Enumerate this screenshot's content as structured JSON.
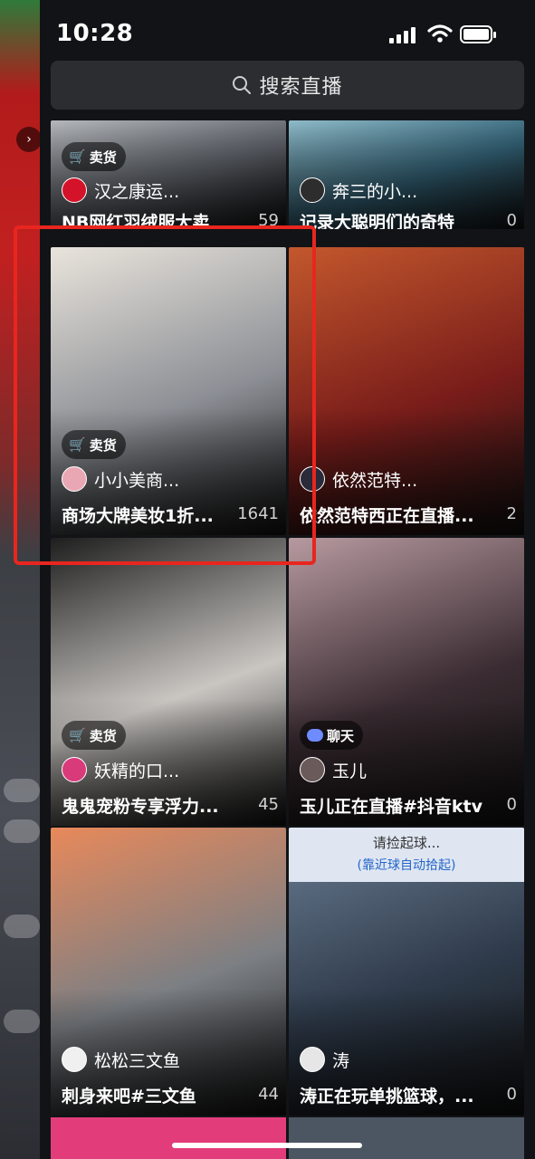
{
  "status_bar": {
    "time": "10:28"
  },
  "search": {
    "placeholder": "搜索直播"
  },
  "cards": [
    {
      "tag": "卖货",
      "host": "汉之康运...",
      "title": "NB网红羽绒服大卖",
      "count": "59",
      "bg": "#6b7078",
      "accent": "#c9cdd2",
      "avatar_color": "#d4132a"
    },
    {
      "tag": "",
      "host": "奔三的小...",
      "title": "记录大聪明们的奇特",
      "count": "0",
      "bg": "#3a6f86",
      "accent": "#9fd0e0",
      "avatar_color": "#2d2d2d"
    },
    {
      "tag": "卖货",
      "host": "小小美商...",
      "title": "商场大牌美妆1折...",
      "count": "1641",
      "bg": "#8c8f95",
      "accent": "#e9e4dc",
      "avatar_color": "#e9a7b4"
    },
    {
      "tag": "",
      "host": "依然范特...",
      "title": "依然范特西正在直播...",
      "count": "2",
      "bg": "#7a1d1a",
      "accent": "#c3582d",
      "avatar_color": "#2a2a3a"
    },
    {
      "tag": "卖货",
      "host": "妖精的口...",
      "title": "鬼鬼宠粉专享浮力...",
      "count": "45",
      "bg": "#c9c6c2",
      "accent": "#1e1e1e",
      "avatar_color": "#d93a7a"
    },
    {
      "tag": "聊天",
      "host": "玉儿",
      "title": "玉儿正在直播#抖音ktv",
      "count": "0",
      "bg": "#3a2c32",
      "accent": "#b79aa0",
      "avatar_color": "#6a5a5a"
    },
    {
      "tag": "",
      "host": "松松三文鱼",
      "title": "刺身来吧#三文鱼",
      "count": "44",
      "bg": "#7b7f84",
      "accent": "#e8895a",
      "avatar_color": "#f0f0f0"
    },
    {
      "tag": "",
      "host": "涛",
      "title": "涛正在玩单挑篮球，...",
      "count": "0",
      "bg": "#2e3a4a",
      "accent": "#6a7c92",
      "avatar_color": "#e6e6e6",
      "game_text_1": "请捡起球...",
      "game_text_2": "(靠近球自动拾起)"
    }
  ],
  "colors": {
    "highlight": "#e8261f",
    "panel": "#121316",
    "search_bg": "#2b2d30"
  },
  "icons": {
    "search": "search-icon",
    "shop": "cart-icon",
    "chat": "chat-bubble-icon",
    "chevron": "chevron-right-icon"
  }
}
